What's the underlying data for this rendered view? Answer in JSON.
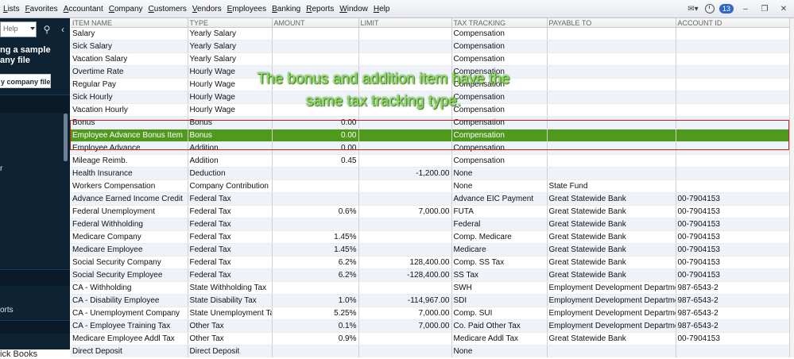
{
  "menu": [
    "Lists",
    "Favorites",
    "Accountant",
    "Company",
    "Customers",
    "Vendors",
    "Employees",
    "Banking",
    "Reports",
    "Window",
    "Help"
  ],
  "topbar": {
    "reminder_count": "13"
  },
  "sidebar": {
    "search_placeholder": "Help",
    "sample_text": "ng a sample\nany file",
    "company_button": "y company file",
    "label_r": "r",
    "label_orts": "orts"
  },
  "footer_text": "ick Books",
  "table": {
    "headers": [
      "ITEM NAME",
      "TYPE",
      "AMOUNT",
      "LIMIT",
      "TAX TRACKING",
      "PAYABLE TO",
      "ACCOUNT ID"
    ],
    "rows": [
      [
        "Salary",
        "Yearly Salary",
        "",
        "",
        "Compensation",
        "",
        ""
      ],
      [
        "Sick Salary",
        "Yearly Salary",
        "",
        "",
        "Compensation",
        "",
        ""
      ],
      [
        "Vacation Salary",
        "Yearly Salary",
        "",
        "",
        "Compensation",
        "",
        ""
      ],
      [
        "Overtime Rate",
        "Hourly Wage",
        "",
        "",
        "Compensation",
        "",
        ""
      ],
      [
        "Regular Pay",
        "Hourly Wage",
        "",
        "",
        "Compensation",
        "",
        ""
      ],
      [
        "Sick Hourly",
        "Hourly Wage",
        "",
        "",
        "Compensation",
        "",
        ""
      ],
      [
        "Vacation Hourly",
        "Hourly Wage",
        "",
        "",
        "Compensation",
        "",
        ""
      ],
      [
        "Bonus",
        "Bonus",
        "0.00",
        "",
        "Compensation",
        "",
        ""
      ],
      [
        "Employee Advance Bonus Item",
        "Bonus",
        "0.00",
        "",
        "Compensation",
        "",
        ""
      ],
      [
        "Employee Advance",
        "Addition",
        "0.00",
        "",
        "Compensation",
        "",
        ""
      ],
      [
        "Mileage Reimb.",
        "Addition",
        "0.45",
        "",
        "Compensation",
        "",
        ""
      ],
      [
        "Health Insurance",
        "Deduction",
        "",
        "-1,200.00",
        "None",
        "",
        ""
      ],
      [
        "Workers Compensation",
        "Company Contribution",
        "",
        "",
        "None",
        "State Fund",
        ""
      ],
      [
        "Advance Earned Income Credit",
        "Federal Tax",
        "",
        "",
        "Advance EIC Payment",
        "Great Statewide Bank",
        "00-7904153"
      ],
      [
        "Federal Unemployment",
        "Federal Tax",
        "0.6%",
        "7,000.00",
        "FUTA",
        "Great Statewide Bank",
        "00-7904153"
      ],
      [
        "Federal Withholding",
        "Federal Tax",
        "",
        "",
        "Federal",
        "Great Statewide Bank",
        "00-7904153"
      ],
      [
        "Medicare Company",
        "Federal Tax",
        "1.45%",
        "",
        "Comp. Medicare",
        "Great Statewide Bank",
        "00-7904153"
      ],
      [
        "Medicare Employee",
        "Federal Tax",
        "1.45%",
        "",
        "Medicare",
        "Great Statewide Bank",
        "00-7904153"
      ],
      [
        "Social Security Company",
        "Federal Tax",
        "6.2%",
        "128,400.00",
        "Comp. SS Tax",
        "Great Statewide Bank",
        "00-7904153"
      ],
      [
        "Social Security Employee",
        "Federal Tax",
        "6.2%",
        "-128,400.00",
        "SS Tax",
        "Great Statewide Bank",
        "00-7904153"
      ],
      [
        "CA - Withholding",
        "State Withholding Tax",
        "",
        "",
        "SWH",
        "Employment Development Department",
        "987-6543-2"
      ],
      [
        "CA - Disability Employee",
        "State Disability Tax",
        "1.0%",
        "-114,967.00",
        "SDI",
        "Employment Development Department",
        "987-6543-2"
      ],
      [
        "CA - Unemployment Company",
        "State Unemployment Tax",
        "5.25%",
        "7,000.00",
        "Comp. SUI",
        "Employment Development Department",
        "987-6543-2"
      ],
      [
        "CA - Employee Training Tax",
        "Other Tax",
        "0.1%",
        "7,000.00",
        "Co. Paid Other Tax",
        "Employment Development Department",
        "987-6543-2"
      ],
      [
        "Medicare Employee Addl Tax",
        "Other Tax",
        "0.9%",
        "",
        "Medicare Addl Tax",
        "Great Statewide Bank",
        "00-7904153"
      ],
      [
        "Direct Deposit",
        "Direct Deposit",
        "",
        "",
        "None",
        "",
        ""
      ]
    ],
    "selected_row": 8
  },
  "annotation": "The bonus and addition item have the same tax tracking type.",
  "colors": {
    "selected_row": "#4f9a1c",
    "highlight_box": "#d61a1a",
    "annotation_text": "#8ee05a",
    "sidebar": "#0d2233"
  }
}
